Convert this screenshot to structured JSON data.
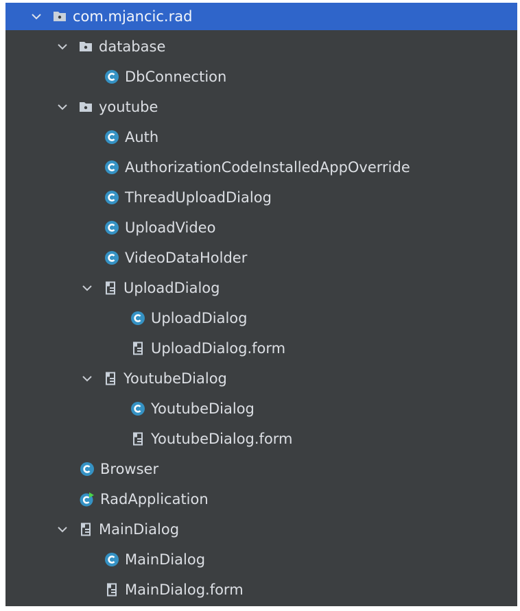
{
  "colors": {
    "panel_bg": "#3c3f41",
    "selection": "#2f65ca",
    "text": "#dcdfe4",
    "class_icon": "#3592c4",
    "folder_icon": "#c9d1da",
    "run_badge": "#4bd34b"
  },
  "tree": {
    "root": {
      "label": "com.mjancic.rad",
      "icon": "package-icon"
    },
    "database": {
      "label": "database",
      "icon": "package-icon"
    },
    "db_connection": {
      "label": "DbConnection",
      "icon": "class-icon"
    },
    "youtube": {
      "label": "youtube",
      "icon": "package-icon"
    },
    "auth": {
      "label": "Auth",
      "icon": "class-icon"
    },
    "auth_override": {
      "label": "AuthorizationCodeInstalledAppOverride",
      "icon": "class-icon"
    },
    "thread_upload_dialog": {
      "label": "ThreadUploadDialog",
      "icon": "class-icon"
    },
    "upload_video": {
      "label": "UploadVideo",
      "icon": "class-icon"
    },
    "video_data_holder": {
      "label": "VideoDataHolder",
      "icon": "class-icon"
    },
    "upload_dialog_group": {
      "label": "UploadDialog",
      "icon": "form-icon"
    },
    "upload_dialog_class": {
      "label": "UploadDialog",
      "icon": "class-icon"
    },
    "upload_dialog_form": {
      "label": "UploadDialog.form",
      "icon": "form-icon"
    },
    "youtube_dialog_group": {
      "label": "YoutubeDialog",
      "icon": "form-icon"
    },
    "youtube_dialog_class": {
      "label": "YoutubeDialog",
      "icon": "class-icon"
    },
    "youtube_dialog_form": {
      "label": "YoutubeDialog.form",
      "icon": "form-icon"
    },
    "browser": {
      "label": "Browser",
      "icon": "class-icon"
    },
    "rad_application": {
      "label": "RadApplication",
      "icon": "runnable-class-icon"
    },
    "main_dialog_group": {
      "label": "MainDialog",
      "icon": "form-icon"
    },
    "main_dialog_class": {
      "label": "MainDialog",
      "icon": "class-icon"
    },
    "main_dialog_form": {
      "label": "MainDialog.form",
      "icon": "form-icon"
    }
  }
}
